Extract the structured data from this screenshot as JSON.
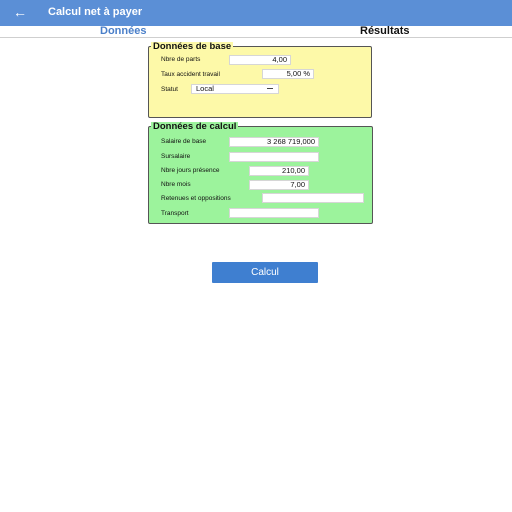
{
  "appbar": {
    "title": "Calcul net à payer",
    "back_icon": "arrow-left-icon",
    "color": "#5b8fd6"
  },
  "tabs": [
    {
      "label": "Données",
      "active": true
    },
    {
      "label": "Résultats",
      "active": false
    }
  ],
  "base": {
    "title": "Données de base",
    "fields": {
      "parts": {
        "label": "Nbre de parts",
        "value": "4,00"
      },
      "taux": {
        "label": "Taux accident travail",
        "value": "5,00 %"
      },
      "statut": {
        "label": "Statut",
        "value": "Local"
      }
    }
  },
  "calc": {
    "title": "Données de calcul",
    "fields": {
      "salaire": {
        "label": "Salaire de base",
        "value": "3 268 719,000"
      },
      "sursalaire": {
        "label": "Sursalaire",
        "value": ""
      },
      "jours": {
        "label": "Nbre jours présence",
        "value": "210,00"
      },
      "mois": {
        "label": "Nbre mois",
        "value": "7,00"
      },
      "retenues": {
        "label": "Retenues et oppositions",
        "value": ""
      },
      "transport": {
        "label": "Transport",
        "value": ""
      }
    }
  },
  "actions": {
    "calcul_label": "Calcul"
  }
}
